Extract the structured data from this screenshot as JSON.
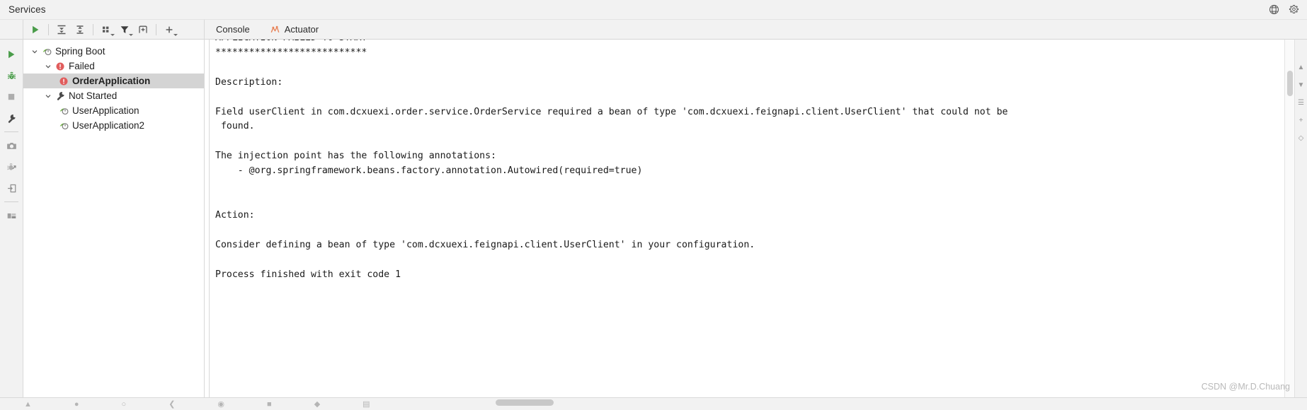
{
  "window": {
    "title": "Services",
    "help_icon": "help-circle-icon",
    "settings_icon": "gear-icon"
  },
  "toolbar": {
    "run_label": "Run",
    "expand_all_label": "Expand All",
    "collapse_all_label": "Collapse All",
    "group_by_label": "Group By",
    "filter_label": "Filter",
    "new_tab_label": "Open in New Tab",
    "add_label": "Add Service"
  },
  "side_toolbar": {
    "items": [
      {
        "name": "rerun-icon",
        "label": "Rerun"
      },
      {
        "name": "debug-icon",
        "label": "Debug"
      },
      {
        "name": "stop-icon",
        "label": "Stop"
      },
      {
        "name": "wrench-icon",
        "label": "Edit Configuration"
      },
      {
        "name": "camera-icon",
        "label": "Capture Memory Snapshot"
      },
      {
        "name": "thread-dump-icon",
        "label": "Thread Dump"
      },
      {
        "name": "attach-icon",
        "label": "Attach"
      },
      {
        "name": "layout-icon",
        "label": "Layout Settings"
      }
    ]
  },
  "tree": {
    "nodes": [
      {
        "label": "Spring Boot",
        "indent": 0,
        "chevron": "down",
        "icon": "spring-boot-icon",
        "selected": false,
        "bold": false
      },
      {
        "label": "Failed",
        "indent": 1,
        "chevron": "down",
        "icon": "error-icon",
        "selected": false,
        "bold": false
      },
      {
        "label": "OrderApplication",
        "indent": 2,
        "chevron": "none",
        "icon": "error-icon",
        "selected": true,
        "bold": true
      },
      {
        "label": "Not Started",
        "indent": 1,
        "chevron": "down",
        "icon": "wrench-icon",
        "selected": false,
        "bold": false
      },
      {
        "label": "UserApplication",
        "indent": 2,
        "chevron": "none",
        "icon": "spring-boot-icon",
        "selected": false,
        "bold": false
      },
      {
        "label": "UserApplication2",
        "indent": 2,
        "chevron": "none",
        "icon": "spring-boot-icon",
        "selected": false,
        "bold": false
      }
    ]
  },
  "tabs": [
    {
      "label": "Console",
      "icon": "none",
      "active": true
    },
    {
      "label": "Actuator",
      "icon": "actuator-icon",
      "active": false
    }
  ],
  "console": {
    "clipped_top_line": "APPLICATION FAILED TO START",
    "text": "***************************\n\nDescription:\n\nField userClient in com.dcxuexi.order.service.OrderService required a bean of type 'com.dcxuexi.feignapi.client.UserClient' that could not be\n found.\n\nThe injection point has the following annotations:\n    - @org.springframework.beans.factory.annotation.Autowired(required=true)\n\n\nAction:\n\nConsider defining a bean of type 'com.dcxuexi.feignapi.client.UserClient' in your configuration.\n\n",
    "exit_line": "Process finished with exit code 1",
    "exit_line_color": "#1a3ae0"
  },
  "watermark": "CSDN @Mr.D.Chuang",
  "colors": {
    "accent_green": "#4a9c4a",
    "error_red": "#e05a5a",
    "actuator_orange": "#e8845a",
    "selection_gray": "#d4d4d4"
  }
}
